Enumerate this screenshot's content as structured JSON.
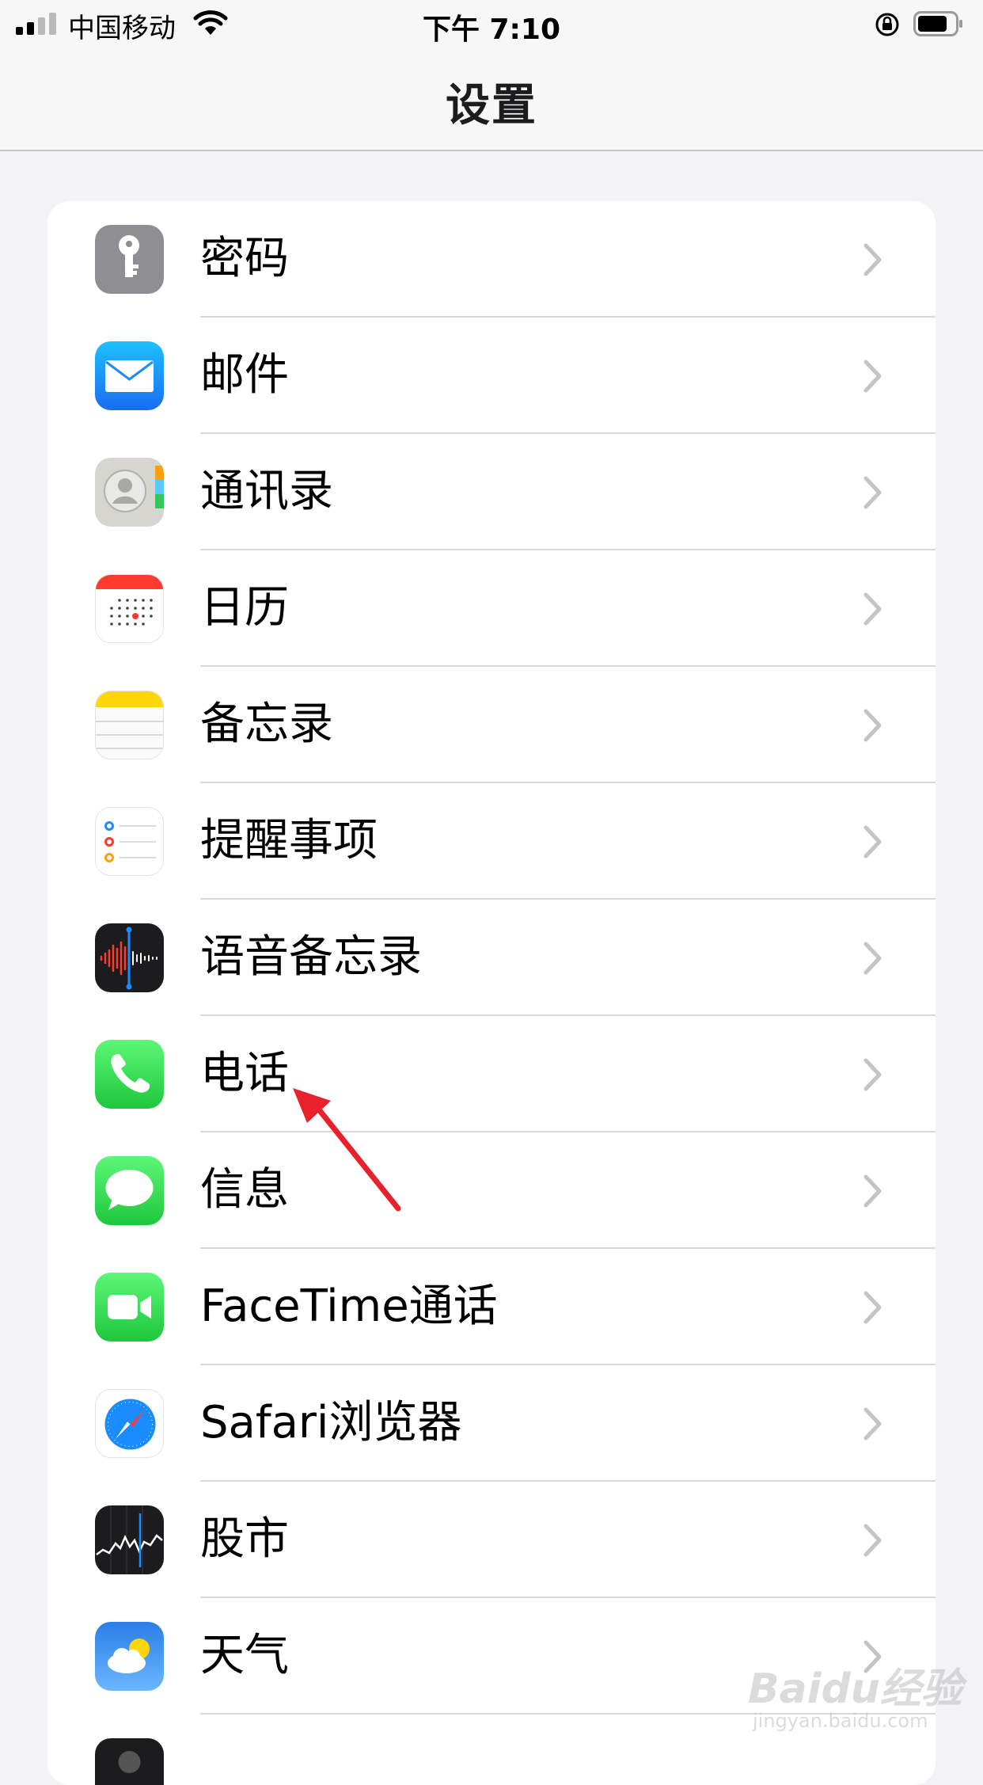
{
  "status_bar": {
    "carrier": "中国移动",
    "time": "下午 7:10"
  },
  "nav": {
    "title": "设置"
  },
  "settings_items": [
    {
      "label": "密码",
      "icon": "key-icon",
      "color": "#8e8e93"
    },
    {
      "label": "邮件",
      "icon": "mail-icon",
      "color": "#1a8cff"
    },
    {
      "label": "通讯录",
      "icon": "contacts-icon",
      "color": "#cfcfcf"
    },
    {
      "label": "日历",
      "icon": "calendar-icon",
      "color": "#ffffff"
    },
    {
      "label": "备忘录",
      "icon": "notes-icon",
      "color": "#ffd60a"
    },
    {
      "label": "提醒事项",
      "icon": "reminders-icon",
      "color": "#ffffff"
    },
    {
      "label": "语音备忘录",
      "icon": "voice-memos-icon",
      "color": "#1c1c1e"
    },
    {
      "label": "电话",
      "icon": "phone-icon",
      "color": "#34c759"
    },
    {
      "label": "信息",
      "icon": "messages-icon",
      "color": "#34c759"
    },
    {
      "label": "FaceTime通话",
      "icon": "facetime-icon",
      "color": "#34c759"
    },
    {
      "label": "Safari浏览器",
      "icon": "safari-icon",
      "color": "#1a8cff"
    },
    {
      "label": "股市",
      "icon": "stocks-icon",
      "color": "#1c1c1e"
    },
    {
      "label": "天气",
      "icon": "weather-icon",
      "color": "#2f7fe8"
    }
  ],
  "watermark": {
    "brand": "Baidu经验",
    "url": "jingyan.baidu.com"
  },
  "colors": {
    "accent_red_arrow": "#e8212b",
    "background": "#f2f2f7"
  }
}
